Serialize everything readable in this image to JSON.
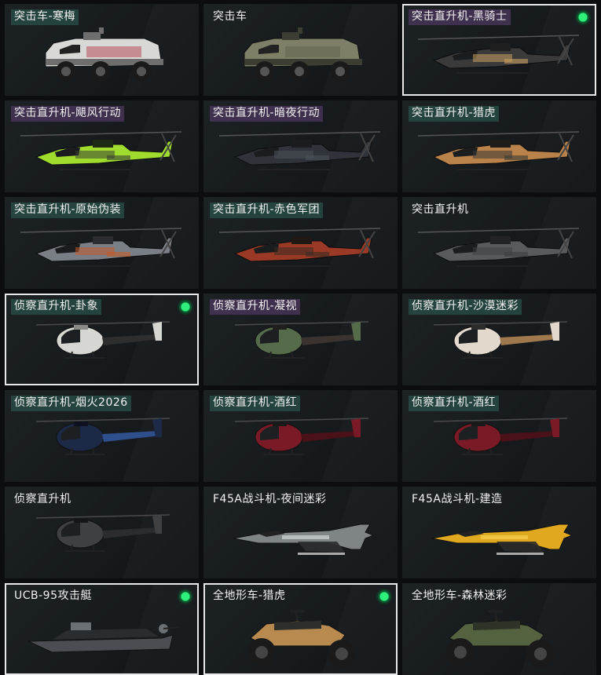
{
  "items": [
    {
      "label": "突击车-寒梅",
      "kind": "apc",
      "tag": "teal",
      "selected": false,
      "equipped": false,
      "colors": [
        "#d8d8d6",
        "#b03040",
        "#6e6e6e"
      ]
    },
    {
      "label": "突击车",
      "kind": "apc",
      "tag": "none",
      "selected": false,
      "equipped": false,
      "colors": [
        "#7d7f66",
        "#5d5f4a",
        "#3d3e33"
      ]
    },
    {
      "label": "突击直升机-黑骑士",
      "kind": "attack-heli",
      "tag": "purple",
      "selected": true,
      "equipped": true,
      "colors": [
        "#3a3a3a",
        "#c9a060",
        "#1f1f1f"
      ]
    },
    {
      "label": "突击直升机-飓风行动",
      "kind": "attack-heli",
      "tag": "purple",
      "selected": false,
      "equipped": false,
      "colors": [
        "#9fdc2e",
        "#3a3f33",
        "#1f2a14"
      ]
    },
    {
      "label": "突击直升机-暗夜行动",
      "kind": "attack-heli",
      "tag": "purple",
      "selected": false,
      "equipped": false,
      "colors": [
        "#30343a",
        "#4b5258",
        "#1a1c1f"
      ]
    },
    {
      "label": "突击直升机-猎虎",
      "kind": "attack-heli",
      "tag": "teal",
      "selected": false,
      "equipped": false,
      "colors": [
        "#b8824a",
        "#3b3a36",
        "#1f1d1a"
      ]
    },
    {
      "label": "突击直升机-原始伪装",
      "kind": "attack-heli",
      "tag": "teal",
      "selected": false,
      "equipped": false,
      "colors": [
        "#7a7f86",
        "#c25a2a",
        "#2a2c30"
      ]
    },
    {
      "label": "突击直升机-赤色军团",
      "kind": "attack-heli",
      "tag": "teal",
      "selected": false,
      "equipped": false,
      "colors": [
        "#9a3a26",
        "#3a2a22",
        "#1f1815"
      ]
    },
    {
      "label": "突击直升机",
      "kind": "attack-heli",
      "tag": "none",
      "selected": false,
      "equipped": false,
      "colors": [
        "#585b5d",
        "#3c3f41",
        "#222426"
      ]
    },
    {
      "label": "侦察直升机-卦象",
      "kind": "scout-heli",
      "tag": "teal",
      "selected": true,
      "equipped": true,
      "colors": [
        "#d6d6d2",
        "#2e2e2e",
        "#8a8a86"
      ]
    },
    {
      "label": "侦察直升机-凝视",
      "kind": "scout-heli",
      "tag": "purple",
      "selected": false,
      "equipped": false,
      "colors": [
        "#556b4a",
        "#3a3330",
        "#1f1f1f"
      ]
    },
    {
      "label": "侦察直升机-沙漠迷彩",
      "kind": "scout-heli",
      "tag": "teal",
      "selected": false,
      "equipped": false,
      "colors": [
        "#e2d8cc",
        "#a0784e",
        "#2c2c2c"
      ]
    },
    {
      "label": "侦察直升机-烟火2026",
      "kind": "scout-heli",
      "tag": "teal",
      "selected": false,
      "equipped": false,
      "colors": [
        "#1c2a48",
        "#2f4e8c",
        "#0e1220"
      ]
    },
    {
      "label": "侦察直升机-酒红",
      "kind": "scout-heli",
      "tag": "teal",
      "selected": false,
      "equipped": false,
      "colors": [
        "#7a1a26",
        "#4a1118",
        "#1a1a1a"
      ]
    },
    {
      "label": "侦察直升机-酒红",
      "kind": "scout-heli",
      "tag": "teal",
      "selected": false,
      "equipped": false,
      "colors": [
        "#7a1a26",
        "#4a1118",
        "#1a1a1a"
      ]
    },
    {
      "label": "侦察直升机",
      "kind": "scout-heli",
      "tag": "none",
      "selected": false,
      "equipped": false,
      "colors": [
        "#3e4042",
        "#2a2c2e",
        "#151617"
      ]
    },
    {
      "label": "F45A战斗机-夜间迷彩",
      "kind": "jet",
      "tag": "none",
      "selected": false,
      "equipped": false,
      "colors": [
        "#7f8487",
        "#2d3033",
        "#c9cccd"
      ]
    },
    {
      "label": "F45A战斗机-建造",
      "kind": "jet",
      "tag": "none",
      "selected": false,
      "equipped": false,
      "colors": [
        "#e0a81e",
        "#2a2a2a",
        "#f2c84a"
      ]
    },
    {
      "label": "UCB-95攻击艇",
      "kind": "boat",
      "tag": "none",
      "selected": true,
      "equipped": true,
      "colors": [
        "#4a4e52",
        "#2a2d30",
        "#6b7075"
      ]
    },
    {
      "label": "全地形车-猎虎",
      "kind": "atv",
      "tag": "none",
      "selected": true,
      "equipped": true,
      "colors": [
        "#b88a50",
        "#2e2e2c",
        "#1a1a19"
      ]
    },
    {
      "label": "全地形车-森林迷彩",
      "kind": "atv",
      "tag": "none",
      "selected": false,
      "equipped": false,
      "colors": [
        "#55623f",
        "#2d3327",
        "#1a1c17"
      ]
    }
  ]
}
